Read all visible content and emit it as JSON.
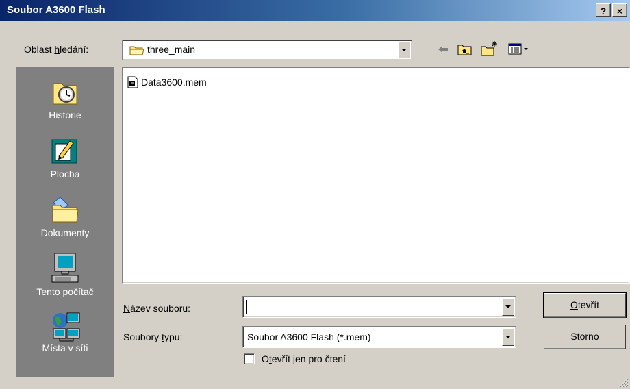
{
  "window": {
    "title": "Soubor A3600 Flash",
    "help_button": "?",
    "close_button": "×"
  },
  "lookin": {
    "label_pre": "Oblast ",
    "label_key": "h",
    "label_post": "ledání:",
    "value": "three_main"
  },
  "toolbar": {
    "back_icon": "back-arrow-icon",
    "up_icon": "up-folder-icon",
    "new_folder_icon": "new-folder-icon",
    "view_menu_icon": "view-menu-icon"
  },
  "places": [
    {
      "label": "Historie",
      "icon": "history-icon"
    },
    {
      "label": "Plocha",
      "icon": "desktop-icon"
    },
    {
      "label": "Dokumenty",
      "icon": "documents-folder-icon"
    },
    {
      "label": "Tento počítač",
      "icon": "computer-icon"
    },
    {
      "label": "Místa v síti",
      "icon": "network-icon"
    }
  ],
  "files": [
    {
      "name": "Data3600.mem",
      "icon": "file-icon"
    }
  ],
  "filename": {
    "label_key": "N",
    "label_post": "ázev souboru:",
    "value": ""
  },
  "filetype": {
    "label_pre": "Soubory ",
    "label_key": "t",
    "label_post": "ypu:",
    "value": "Soubor A3600 Flash (*.mem)"
  },
  "readonly": {
    "label_pre": "O",
    "label_key": "t",
    "label_post": "evřít jen pro čtení",
    "checked": false
  },
  "buttons": {
    "open_key": "O",
    "open_post": "tevřít",
    "cancel": "Storno"
  }
}
